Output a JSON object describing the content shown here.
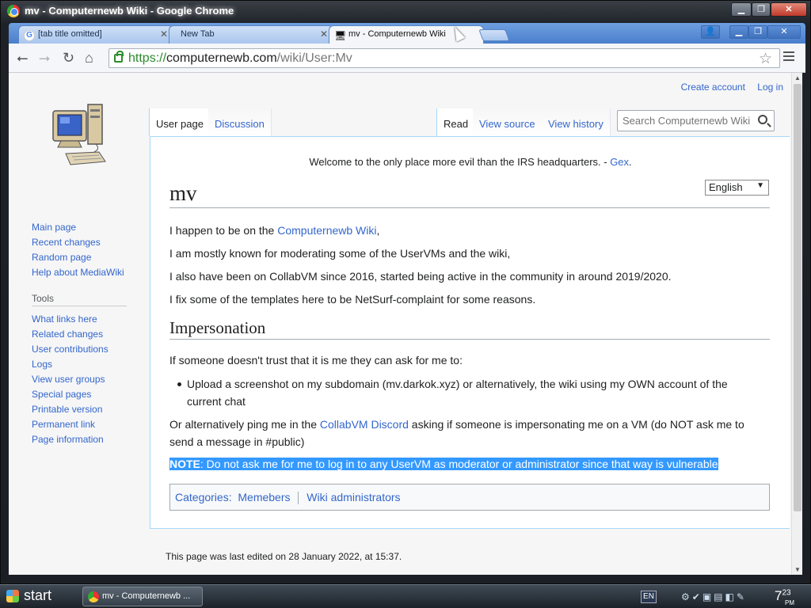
{
  "window": {
    "title": "mv - Computernewb Wiki - Google Chrome"
  },
  "tabs": [
    {
      "label": "[tab title omitted]",
      "icon": "google-icon",
      "active": false
    },
    {
      "label": "New Tab",
      "icon": "",
      "active": false
    },
    {
      "label": "mv - Computernewb Wiki",
      "icon": "site-icon",
      "active": true
    }
  ],
  "toolbar": {
    "url_scheme": "https://",
    "url_host": "computernewb.com",
    "url_path": "/wiki/User:Mv"
  },
  "personal": {
    "create_account": "Create account",
    "log_in": "Log in"
  },
  "nav_main": [
    "Main page",
    "Recent changes",
    "Random page",
    "Help about MediaWiki"
  ],
  "tools": {
    "heading": "Tools",
    "items": [
      "What links here",
      "Related changes",
      "User contributions",
      "Logs",
      "View user groups",
      "Special pages",
      "Printable version",
      "Permanent link",
      "Page information"
    ]
  },
  "content_tabs": {
    "user_page": "User page",
    "discussion": "Discussion",
    "read": "Read",
    "view_source": "View source",
    "view_history": "View history"
  },
  "search": {
    "placeholder": "Search Computernewb Wiki"
  },
  "sitenotice": {
    "text": "Welcome to the only place more evil than the IRS headquarters. - ",
    "link": "Gex",
    "end": "."
  },
  "language": {
    "selected": "English"
  },
  "page": {
    "title": "mv",
    "p1_text": "I happen to be on the ",
    "p1_link": "Computernewb Wiki",
    "p1_end": ",",
    "p2": "I am mostly known for moderating some of the UserVMs and the wiki,",
    "p3": "I also have been on CollabVM since 2016, started being active in the community in around 2019/2020.",
    "p4": "I fix some of the templates here to be NetSurf-complaint for some reasons.",
    "section_heading": "Impersonation",
    "p5": "If someone doesn't trust that it is me they can ask for me to:",
    "bullet": "Upload a screenshot on my subdomain (mv.darkok.xyz) or alternatively, the wiki using my OWN account of the current chat",
    "p6_text": "Or alternatively ping me in the ",
    "p6_link": "CollabVM Discord",
    "p6_end": " asking if someone is impersonating me on a VM (do NOT ask me to send a message in #public)",
    "note_label": "NOTE",
    "note_text": ": Do not ask me for me to log in to any UserVM as moderator or administrator since that way is vulnerable"
  },
  "categories": {
    "label": "Categories:",
    "items": [
      "Memebers",
      "Wiki administrators"
    ]
  },
  "footer": {
    "last_edited": "This page was last edited on 28 January 2022, at 15:37."
  },
  "taskbar": {
    "start": "start",
    "task_label": "mv - Computernewb ...",
    "lang": "EN",
    "clock_hour": "7",
    "clock_min": "23",
    "clock_ampm": "PM"
  }
}
